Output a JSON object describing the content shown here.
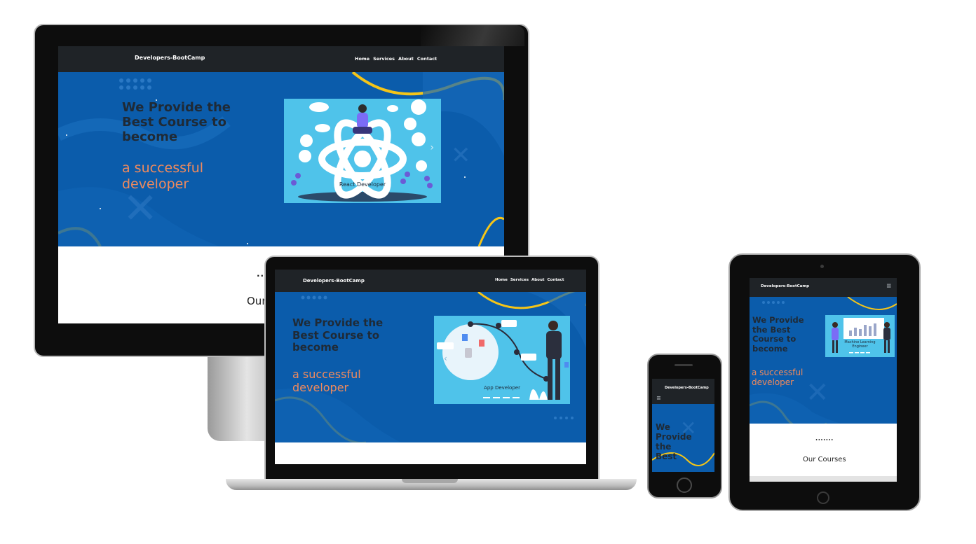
{
  "site": {
    "brand": "Developers-BootCamp",
    "nav_links": [
      "Home",
      "Services",
      "About",
      "Contact"
    ],
    "hero_title_lines": [
      "We Provide the",
      "Best Course to",
      "become"
    ],
    "hero_subtitle_lines": [
      "a successful",
      "developer"
    ],
    "section_dots": "........",
    "section_heading": "Our Courses",
    "section_heading_partial": "Our",
    "colors": {
      "navbar": "#1f2327",
      "hero": "#0b5cab",
      "accent": "#f08a5d",
      "wave": "#f5c518",
      "card": "#4fc3ea"
    }
  },
  "desktop": {
    "slide_caption": "React Developer",
    "next_arrow": "›"
  },
  "laptop": {
    "slide_caption": "App Developer",
    "prev_arrow": "‹"
  },
  "tablet": {
    "hero_title_lines": [
      "We Provide",
      "the Best",
      "Course to",
      "become"
    ],
    "slide_caption_lines": [
      "Machine Learning",
      "Engineer"
    ],
    "menu_icon": "≡",
    "section_dots": "•••••••",
    "section_heading": "Our Courses"
  },
  "phone": {
    "hero_title_lines": [
      "We",
      "Provide",
      "the",
      "Best"
    ],
    "menu_icon": "≡"
  }
}
